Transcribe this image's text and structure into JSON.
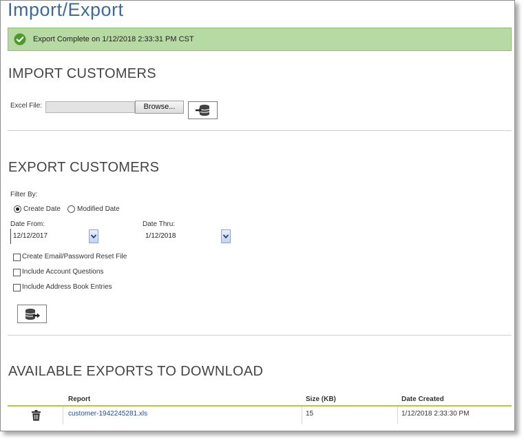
{
  "page": {
    "title": "Import/Export"
  },
  "alert": {
    "message": "Export Complete on 1/12/2018 2:33:31 PM CST",
    "color": "#b7d9a3",
    "icon": "check-circle-icon"
  },
  "import_section": {
    "title": "IMPORT CUSTOMERS",
    "excel_label": "Excel File:",
    "file_value": "",
    "browse_label": "Browse...",
    "import_button_icon": "database-import-icon"
  },
  "export_section": {
    "title": "EXPORT CUSTOMERS",
    "filter_by_label": "Filter By:",
    "filter_options": [
      {
        "label": "Create Date",
        "selected": true
      },
      {
        "label": "Modified Date",
        "selected": false
      }
    ],
    "date_from_label": "Date From:",
    "date_from_value": "12/12/2017",
    "date_thru_label": "Date Thru:",
    "date_thru_value": "1/12/2018",
    "options": [
      {
        "label": "Create Email/Password Reset File",
        "checked": false
      },
      {
        "label": "Include Account Questions",
        "checked": false
      },
      {
        "label": "Include Address Book Entries",
        "checked": false
      }
    ],
    "export_button_icon": "database-export-icon"
  },
  "downloads_section": {
    "title": "AVAILABLE EXPORTS TO DOWNLOAD",
    "columns": [
      "Report",
      "Size (KB)",
      "Date Created"
    ],
    "rows": [
      {
        "report": "customer-1942245281.xls",
        "size": "15",
        "date_created": "1/12/2018 2:33:30 PM"
      }
    ]
  }
}
